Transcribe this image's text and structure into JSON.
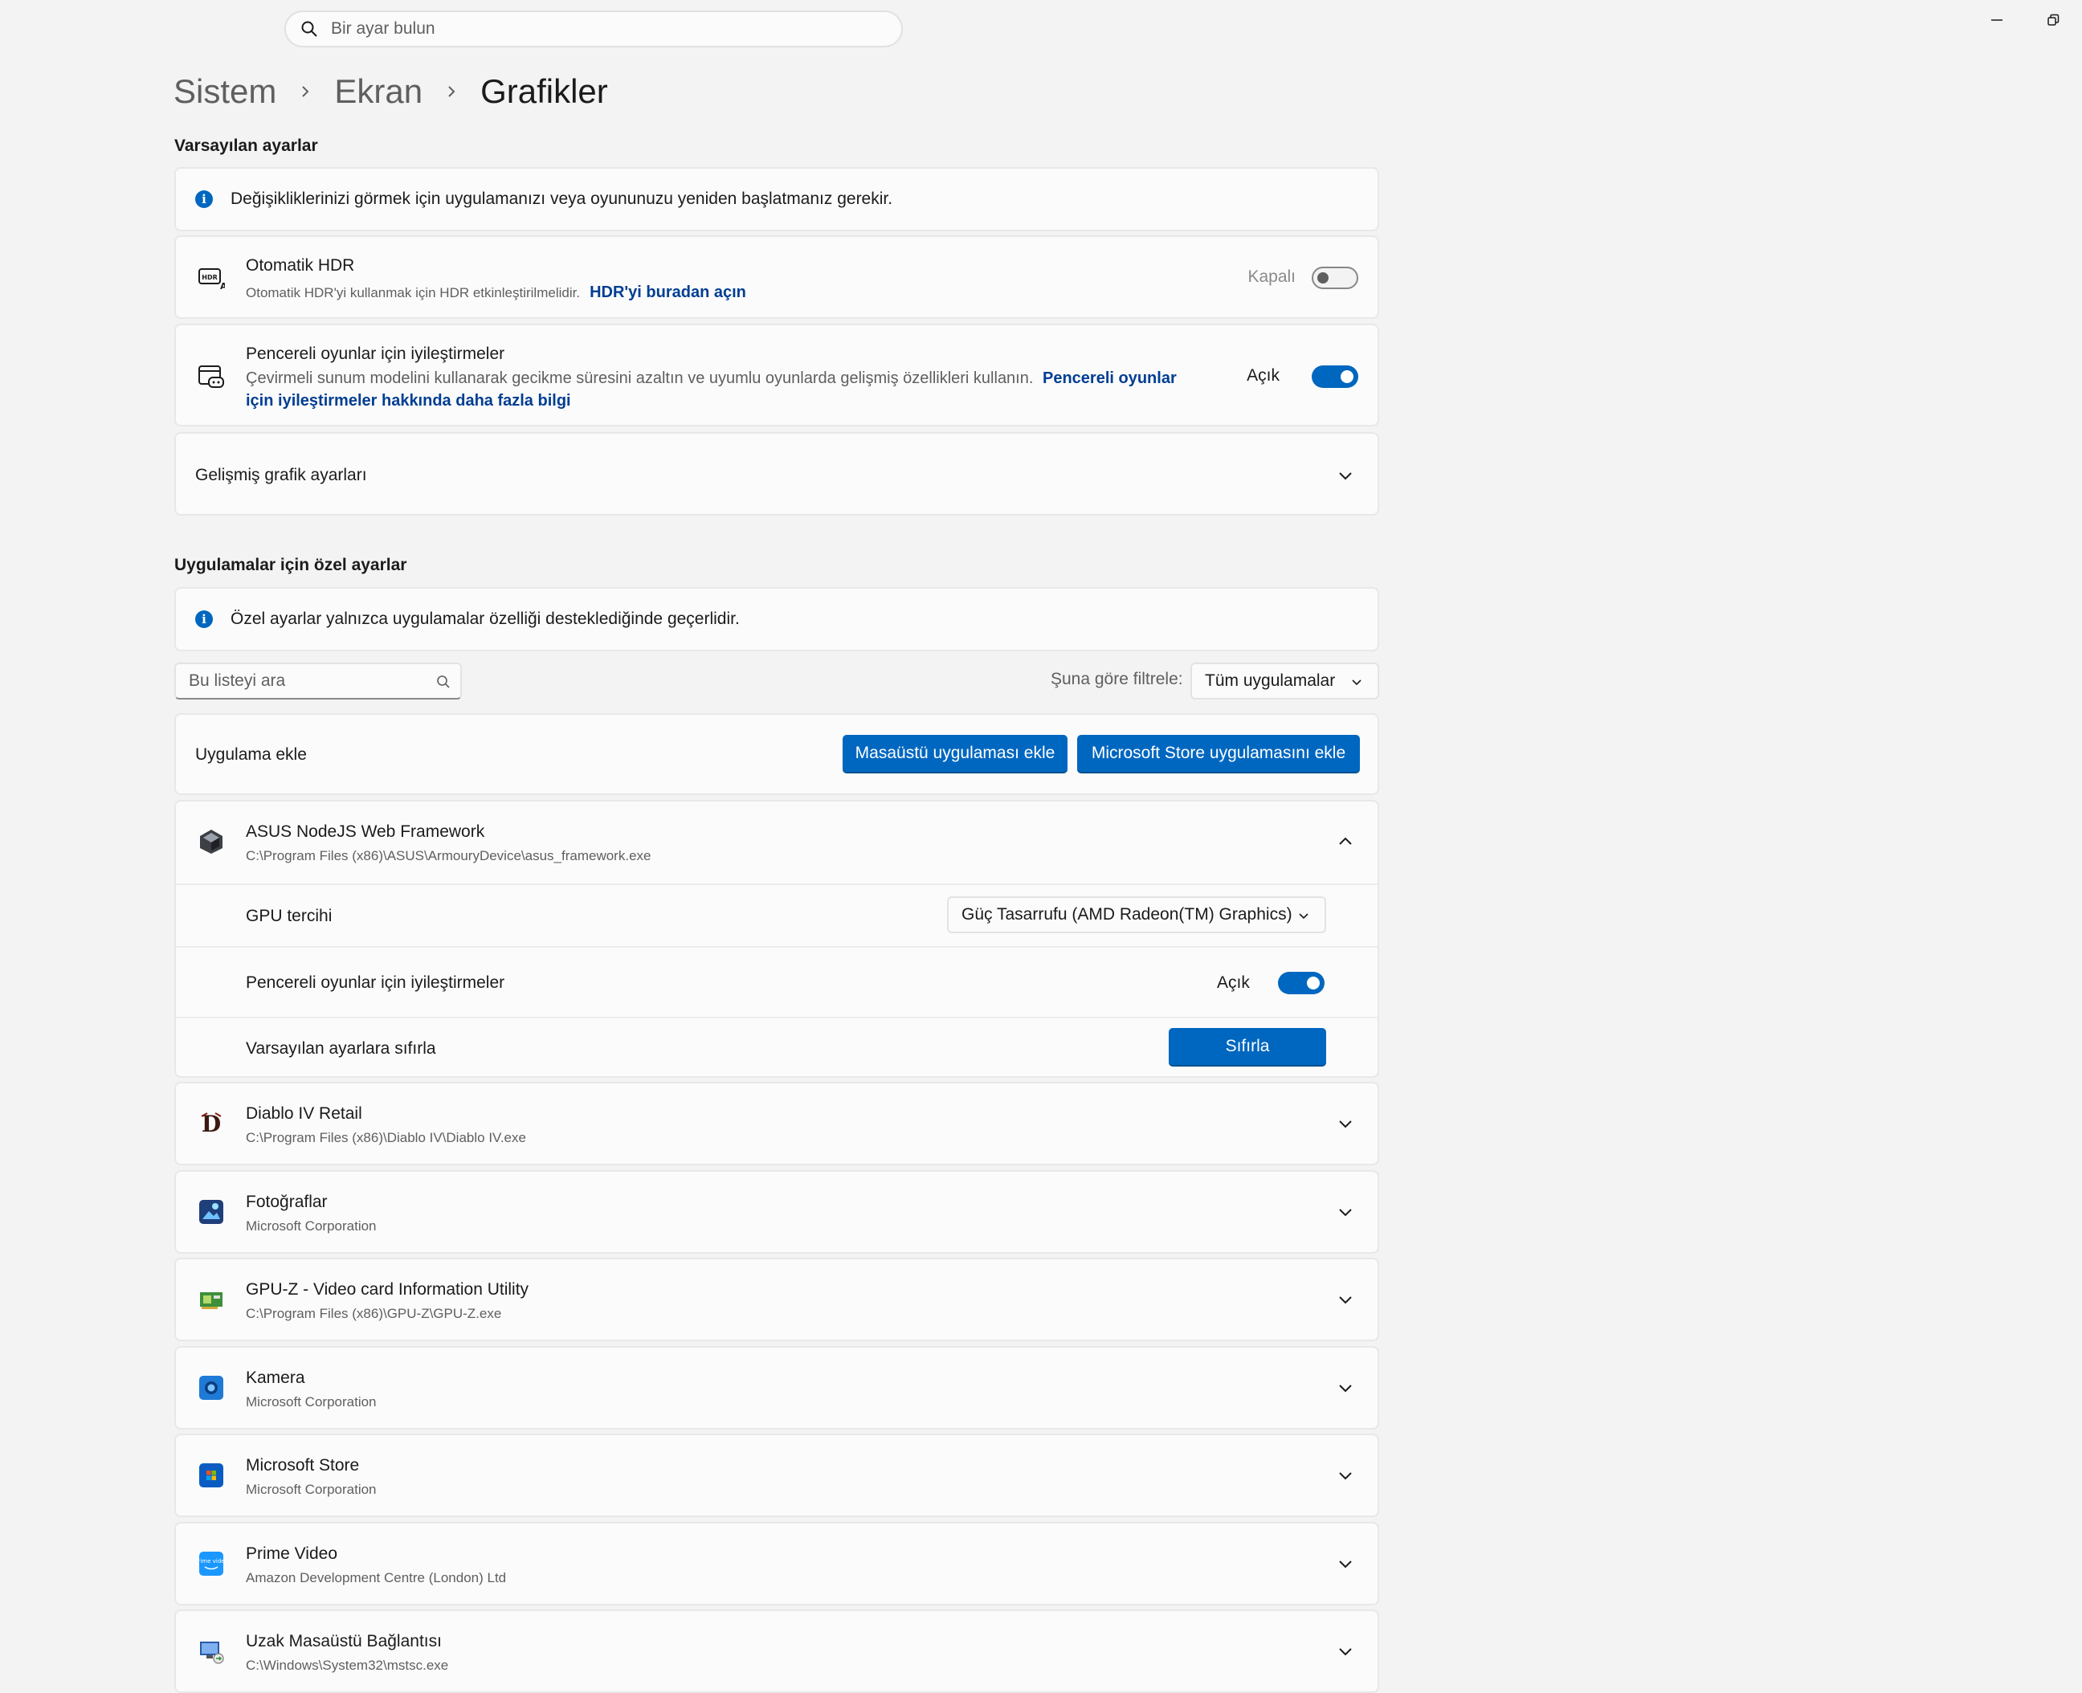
{
  "titlebar": {
    "search_placeholder": "Bir ayar bulun"
  },
  "breadcrumb": [
    "Sistem",
    "Ekran",
    "Grafikler"
  ],
  "default_settings": {
    "title": "Varsayılan ayarlar",
    "info": "Değişikliklerinizi görmek için uygulamanızı veya oyununuzu yeniden başlatmanız gerekir.",
    "auto_hdr": {
      "title": "Otomatik HDR",
      "subtitle": "Otomatik HDR'yi kullanmak için HDR etkinleştirilmelidir.",
      "link": "HDR'yi buradan açın",
      "state": "Kapalı",
      "on": false
    },
    "windowed_games": {
      "title": "Pencereli oyunlar için iyileştirmeler",
      "subtitle": "Çevirmeli sunum modelini kullanarak gecikme süresini azaltın ve uyumlu oyunlarda gelişmiş özellikleri kullanın.",
      "link_part1": "Pencereli oyunlar",
      "link_part2": "için iyileştirmeler hakkında daha fazla bilgi",
      "state": "Açık",
      "on": true
    },
    "advanced": "Gelişmiş grafik ayarları"
  },
  "app_settings": {
    "title": "Uygulamalar için özel ayarlar",
    "info": "Özel ayarlar yalnızca uygulamalar özelliği desteklediğinde geçerlidir.",
    "search_placeholder": "Bu listeyi ara",
    "filter_label": "Şuna göre filtrele:",
    "filter_value": "Tüm uygulamalar",
    "add_app_label": "Uygulama ekle",
    "add_desktop_button": "Masaüstü uygulaması ekle",
    "add_store_button": "Microsoft Store uygulamasını ekle",
    "expanded_app": {
      "name": "ASUS NodeJS Web Framework",
      "path": "C:\\Program Files (x86)\\ASUS\\ArmouryDevice\\asus_framework.exe",
      "gpu_label": "GPU tercihi",
      "gpu_value": "Güç Tasarrufu (AMD Radeon(TM) Graphics)",
      "windowed_label": "Pencereli oyunlar için iyileştirmeler",
      "windowed_state": "Açık",
      "reset_label": "Varsayılan ayarlara sıfırla",
      "reset_button": "Sıfırla"
    },
    "apps": [
      {
        "name": "Diablo IV Retail",
        "sub": "C:\\Program Files (x86)\\Diablo IV\\Diablo IV.exe",
        "icon": "diablo-icon"
      },
      {
        "name": "Fotoğraflar",
        "sub": "Microsoft Corporation",
        "icon": "photos-icon"
      },
      {
        "name": "GPU-Z - Video card Information Utility",
        "sub": "C:\\Program Files (x86)\\GPU-Z\\GPU-Z.exe",
        "icon": "gpuz-icon"
      },
      {
        "name": "Kamera",
        "sub": "Microsoft Corporation",
        "icon": "camera-icon"
      },
      {
        "name": "Microsoft Store",
        "sub": "Microsoft Corporation",
        "icon": "store-icon"
      },
      {
        "name": "Prime Video",
        "sub": "Amazon Development Centre (London) Ltd",
        "icon": "prime-video-icon",
        "badge": "prime video"
      },
      {
        "name": "Uzak Masaüstü Bağlantısı",
        "sub": "C:\\Windows\\System32\\mstsc.exe",
        "icon": "remote-desktop-icon"
      }
    ]
  },
  "colors": {
    "accent": "#0067c0",
    "link": "#003e92",
    "background": "#f3f3f3",
    "card": "#fbfbfb"
  }
}
